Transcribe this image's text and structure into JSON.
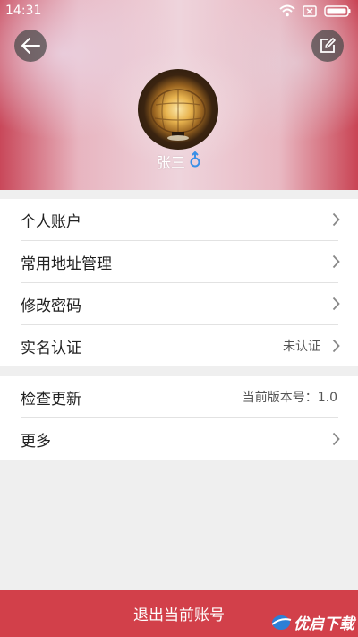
{
  "status_bar": {
    "time": "14:31"
  },
  "profile": {
    "name": "张三"
  },
  "menu_group1": [
    {
      "label": "个人账户",
      "value": ""
    },
    {
      "label": "常用地址管理",
      "value": ""
    },
    {
      "label": "修改密码",
      "value": ""
    },
    {
      "label": "实名认证",
      "value": "未认证"
    }
  ],
  "menu_group2": [
    {
      "label": "检查更新",
      "value": "当前版本号：1.0"
    },
    {
      "label": "更多",
      "value": ""
    }
  ],
  "logout_label": "退出当前账号",
  "watermark_text": "优启下载"
}
